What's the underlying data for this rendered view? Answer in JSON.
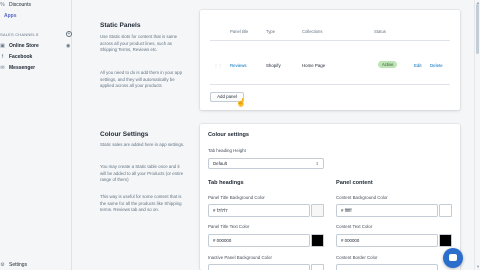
{
  "sidebar": {
    "top_items": [
      {
        "label": "Discounts",
        "icon": "discount-icon"
      },
      {
        "label": "Apps",
        "icon": "apps-icon",
        "active": true
      }
    ],
    "channels_heading": "SALES CHANNELS",
    "channels": [
      {
        "label": "Online Store",
        "icon": "store-icon"
      },
      {
        "label": "Facebook",
        "icon": "facebook-icon"
      },
      {
        "label": "Messenger",
        "icon": "messenger-icon"
      }
    ],
    "settings_label": "Settings"
  },
  "static_panels": {
    "title": "Static Panels",
    "description_1": "Use Static slots for content that is same across all your product lines, such as Shipping Terms, Reviews etc.",
    "description_2": "All you need to do is add them in your app settings, and they will automatically be applied across all your products",
    "table": {
      "headers": [
        "Panel title",
        "Type",
        "Collections",
        "Status"
      ],
      "rows": [
        {
          "title": "Reviews",
          "type": "Shopify",
          "collections": "Home Page",
          "status": "Active",
          "edit": "Edit",
          "delete": "Delete"
        }
      ]
    },
    "add_button": "Add panel"
  },
  "colour_settings": {
    "title": "Colour Settings",
    "description_1": "Static sales are added here in app settings.",
    "description_2": "You may create a Static table once and it will be added to all your Products (or entire range of them)",
    "description_3": "This way is useful for some content that is the same for all the products like Shipping terms. Reviews tab and so on.",
    "card_title": "Colour settings",
    "tab_heading_height_label": "Tab heading Height",
    "tab_heading_height_value": "Default",
    "tab_headings": {
      "heading": "Tab headings",
      "bg_label": "Panel Title Background Color",
      "bg_value": "# f7f7f7",
      "bg_color": "#f7f7f7",
      "text_label": "Panel Title Text Color",
      "text_value": "# 000000",
      "text_color": "#000000",
      "inactive_label": "Inactive Panel Background Color"
    },
    "panel_content": {
      "heading": "Panel content",
      "bg_label": "Content Background Color",
      "bg_value": "# ffffff",
      "bg_color": "#ffffff",
      "text_label": "Content Text Color",
      "text_value": "# 000000",
      "text_color": "#000000",
      "border_label": "Content Border Color"
    }
  },
  "accent_color": "#5c6ac4",
  "badge_color": "#bbe5b3",
  "link_color": "#006fbb"
}
